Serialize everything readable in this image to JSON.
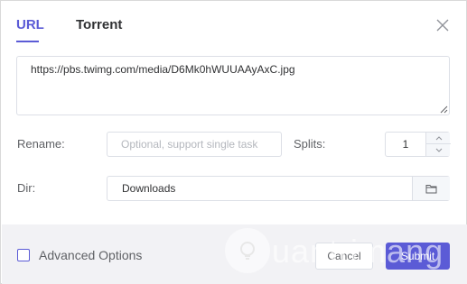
{
  "tabs": [
    {
      "label": "URL",
      "active": true
    },
    {
      "label": "Torrent",
      "active": false
    }
  ],
  "url_field": {
    "value": "https://pbs.twimg.com/media/D6Mk0hWUUAAyAxC.jpg"
  },
  "rename": {
    "label": "Rename:",
    "placeholder": "Optional, support single task"
  },
  "splits": {
    "label": "Splits:",
    "value": "1"
  },
  "dir": {
    "label": "Dir:",
    "value": "Downloads"
  },
  "footer": {
    "advanced_label": "Advanced Options",
    "cancel_label": "Cancel",
    "submit_label": "Submit"
  },
  "watermark": {
    "text": "uantrimang"
  },
  "icons": {
    "close": "close-icon",
    "folder": "folder-icon",
    "step_up": "chevron-up-icon",
    "step_down": "chevron-down-icon",
    "watermark": "lightbulb-icon"
  },
  "colors": {
    "accent": "#5b5bd6",
    "footer_bg": "#f2f2f5",
    "border": "#dcdfe6"
  }
}
